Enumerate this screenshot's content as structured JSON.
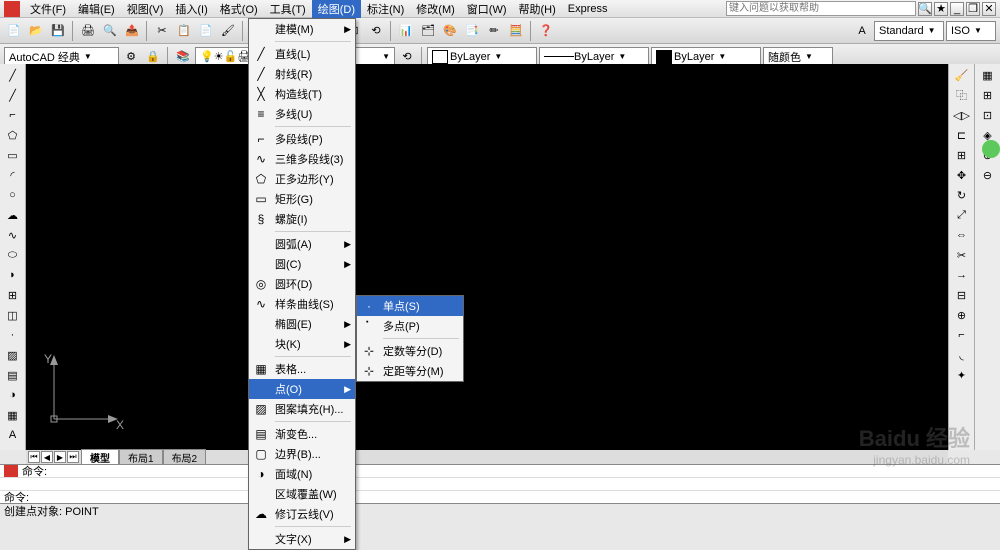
{
  "menubar": {
    "items": [
      "文件(F)",
      "编辑(E)",
      "视图(V)",
      "插入(I)",
      "格式(O)",
      "工具(T)",
      "绘图(D)",
      "标注(N)",
      "修改(M)",
      "窗口(W)",
      "帮助(H)",
      "Express"
    ],
    "active_index": 6,
    "search_placeholder": "键入问题以获取帮助"
  },
  "toolbar2": {
    "workspace": "AutoCAD 经典",
    "layer_label": "ByLayer",
    "linetype_label": "ByLayer",
    "lineweight_label": "ByLayer",
    "color_label": "随颜色",
    "style_label": "Standard",
    "dim_label": "ISO"
  },
  "draw_menu": {
    "items": [
      {
        "label": "建模(M)",
        "icon": "",
        "arrow": true
      },
      {
        "sep": true
      },
      {
        "label": "直线(L)",
        "icon": "╱"
      },
      {
        "label": "射线(R)",
        "icon": "╱"
      },
      {
        "label": "构造线(T)",
        "icon": "╳"
      },
      {
        "label": "多线(U)",
        "icon": "≡"
      },
      {
        "sep": true
      },
      {
        "label": "多段线(P)",
        "icon": "⌐"
      },
      {
        "label": "三维多段线(3)",
        "icon": "∿"
      },
      {
        "label": "正多边形(Y)",
        "icon": "⬠"
      },
      {
        "label": "矩形(G)",
        "icon": "▭"
      },
      {
        "label": "螺旋(I)",
        "icon": "§"
      },
      {
        "sep": true
      },
      {
        "label": "圆弧(A)",
        "icon": "",
        "arrow": true
      },
      {
        "label": "圆(C)",
        "icon": "",
        "arrow": true
      },
      {
        "label": "圆环(D)",
        "icon": "◎"
      },
      {
        "label": "样条曲线(S)",
        "icon": "∿"
      },
      {
        "label": "椭圆(E)",
        "icon": "",
        "arrow": true
      },
      {
        "label": "块(K)",
        "icon": "",
        "arrow": true
      },
      {
        "sep": true
      },
      {
        "label": "表格...",
        "icon": "▦"
      },
      {
        "label": "点(O)",
        "icon": "",
        "arrow": true,
        "hl": true
      },
      {
        "label": "图案填充(H)...",
        "icon": "▨"
      },
      {
        "sep": true
      },
      {
        "label": "渐变色...",
        "icon": "▤"
      },
      {
        "label": "边界(B)...",
        "icon": "▢"
      },
      {
        "label": "面域(N)",
        "icon": "◑"
      },
      {
        "label": "区域覆盖(W)",
        "icon": ""
      },
      {
        "label": "修订云线(V)",
        "icon": "☁"
      },
      {
        "sep": true
      },
      {
        "label": "文字(X)",
        "icon": "",
        "arrow": true
      }
    ]
  },
  "point_submenu": {
    "items": [
      {
        "label": "单点(S)",
        "icon": "·",
        "hl": true
      },
      {
        "label": "多点(P)",
        "icon": "⠁"
      },
      {
        "sep": true
      },
      {
        "label": "定数等分(D)",
        "icon": "⊹"
      },
      {
        "label": "定距等分(M)",
        "icon": "⊹"
      }
    ]
  },
  "tabs": {
    "items": [
      "模型",
      "布局1",
      "布局2"
    ],
    "active": 0
  },
  "command": {
    "prompt": "命令:",
    "history": "命令:"
  },
  "status": {
    "text": "创建点对象:  POINT"
  },
  "watermark": {
    "main": "Baidu 经验",
    "sub": "jingyan.baidu.com"
  }
}
